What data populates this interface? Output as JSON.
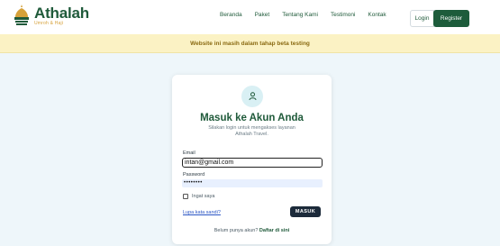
{
  "header": {
    "logo_title": "Athalah",
    "logo_subtitle": "Umroh & Haji",
    "nav": [
      "Beranda",
      "Paket",
      "Tentang Kami",
      "Testimoni",
      "Kontak"
    ],
    "login_label": "Login",
    "register_label": "Register",
    "icons": {
      "logo": "mosque-dome-logo-icon"
    }
  },
  "banner": {
    "text": "Website ini masih dalam tahap beta testing"
  },
  "login_card": {
    "icon": "user-icon",
    "title": "Masuk ke Akun Anda",
    "subtitle": "Silakan login untuk mengakses layanan Athalah Travel.",
    "email_label": "Email",
    "email_value": "intan@gmail.com",
    "password_label": "Password",
    "password_value": "••••••••",
    "remember_label": "Ingat saya",
    "forgot_label": "Lupa kata sandi?",
    "submit_label": "MASUK",
    "signup_prompt": "Belum punya akun?",
    "signup_link": "Daftar di sini"
  },
  "colors": {
    "brand_green": "#1d5c3b",
    "gold": "#d6a13a",
    "banner_bg": "#fbf2c4",
    "page_bg": "#eef6fa",
    "button_dark": "#1c2a3a"
  }
}
